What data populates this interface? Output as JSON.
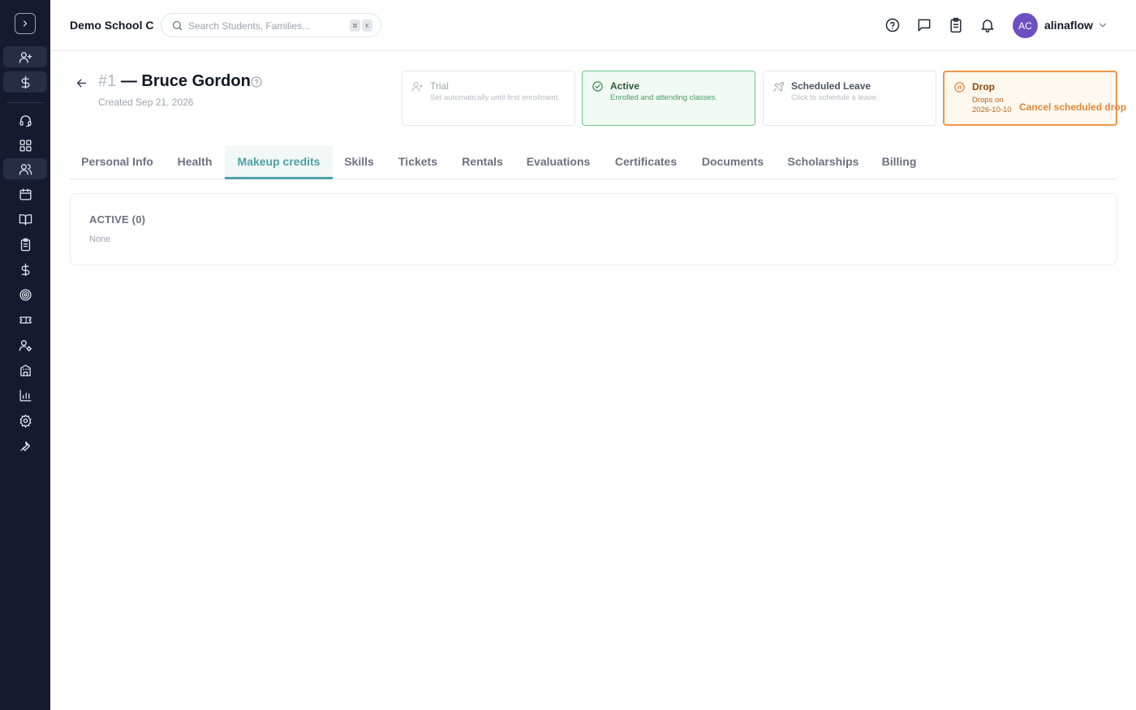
{
  "header": {
    "school_name": "Demo School C",
    "search_placeholder": "Search Students, Families...",
    "shortcut_keys": [
      "⌘",
      "K"
    ],
    "user_initials": "AC",
    "username": "alinaflow"
  },
  "student": {
    "number": "#1",
    "name": "— Bruce Gordon",
    "created": "Created Sep 21, 2026"
  },
  "status_cards": [
    {
      "key": "trial",
      "title": "Trial",
      "description": "Set automatically until first enrollment."
    },
    {
      "key": "active",
      "title": "Active",
      "description": "Enrolled and attending classes."
    },
    {
      "key": "leave",
      "title": "Scheduled Leave",
      "description": "Click to schedule a leave."
    },
    {
      "key": "drop",
      "title": "Drop",
      "description": "Drops on 2026-10-10",
      "action_label": "Cancel scheduled drop"
    }
  ],
  "tabs": [
    {
      "label": "Personal Info"
    },
    {
      "label": "Health"
    },
    {
      "label": "Makeup credits",
      "active": true
    },
    {
      "label": "Skills"
    },
    {
      "label": "Tickets"
    },
    {
      "label": "Rentals"
    },
    {
      "label": "Evaluations"
    },
    {
      "label": "Certificates"
    },
    {
      "label": "Documents"
    },
    {
      "label": "Scholarships"
    },
    {
      "label": "Billing"
    }
  ],
  "panel": {
    "title": "ACTIVE (0)",
    "empty_text": "None"
  },
  "colors": {
    "sidebar_bg": "#151a30",
    "accent_teal": "#4fa0a5",
    "active_green": "#6cc685",
    "drop_orange": "#ef9647",
    "avatar_purple": "#6d4fc2"
  },
  "sidebar_icons": [
    "chevron-right-icon",
    "user-plus-icon",
    "dollar-icon",
    "headset-icon",
    "dashboard-icon",
    "users-icon",
    "calendar-icon",
    "book-icon",
    "clipboard-icon",
    "dollar-icon",
    "target-icon",
    "ticket-icon",
    "user-settings-icon",
    "building-icon",
    "bar-chart-icon",
    "gear-icon",
    "wrench-icon"
  ]
}
